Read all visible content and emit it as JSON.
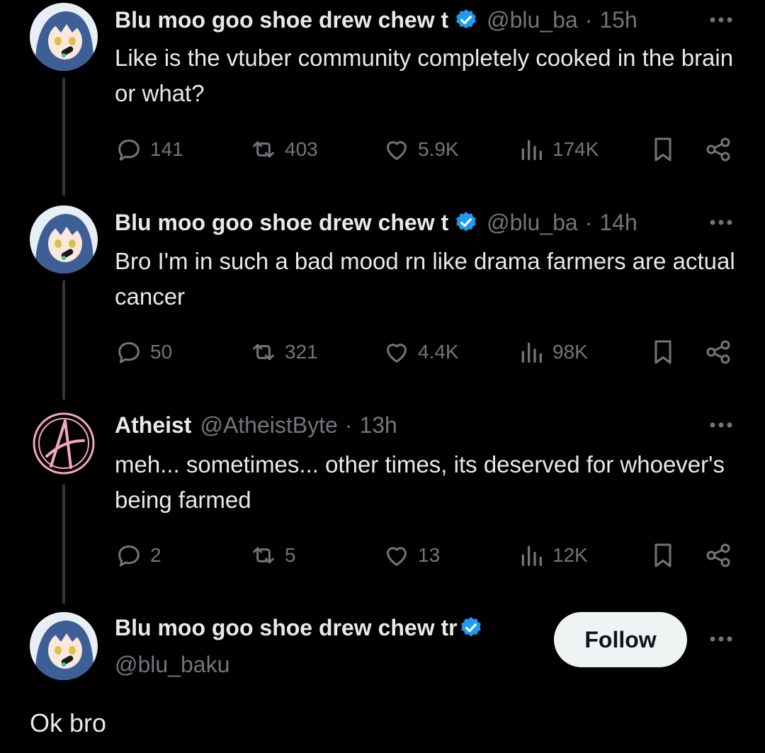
{
  "colors": {
    "background": "#000000",
    "text": "#e7e9ea",
    "muted": "#71767b",
    "verified": "#1d9bf0",
    "thread_line": "#333639",
    "follow_bg": "#eff3f4"
  },
  "tweets": [
    {
      "name": "Blu moo goo shoe drew chew t",
      "handle": "@blu_ba",
      "time": "15h",
      "text": "Like is the vtuber community completely cooked in the brain or what?",
      "replies": "141",
      "reposts": "403",
      "likes": "5.9K",
      "views": "174K"
    },
    {
      "name": "Blu moo goo shoe drew chew t",
      "handle": "@blu_ba",
      "time": "14h",
      "text": "Bro I'm in such a bad mood rn like drama farmers are actual cancer",
      "replies": "50",
      "reposts": "321",
      "likes": "4.4K",
      "views": "98K"
    },
    {
      "name": "Atheist",
      "handle": "@AtheistByte",
      "time": "13h",
      "text": "meh... sometimes... other times, its deserved for whoever's being farmed",
      "replies": "2",
      "reposts": "5",
      "likes": "13",
      "views": "12K"
    }
  ],
  "profile": {
    "name": "Blu moo goo shoe drew chew tr",
    "handle": "@blu_baku",
    "follow_label": "Follow"
  },
  "caption": "Ok bro",
  "icons": [
    "reply-icon",
    "repost-icon",
    "like-icon",
    "views-icon",
    "bookmark-icon",
    "share-icon",
    "more-icon",
    "verified-badge-icon",
    "anarchist-a-icon"
  ]
}
